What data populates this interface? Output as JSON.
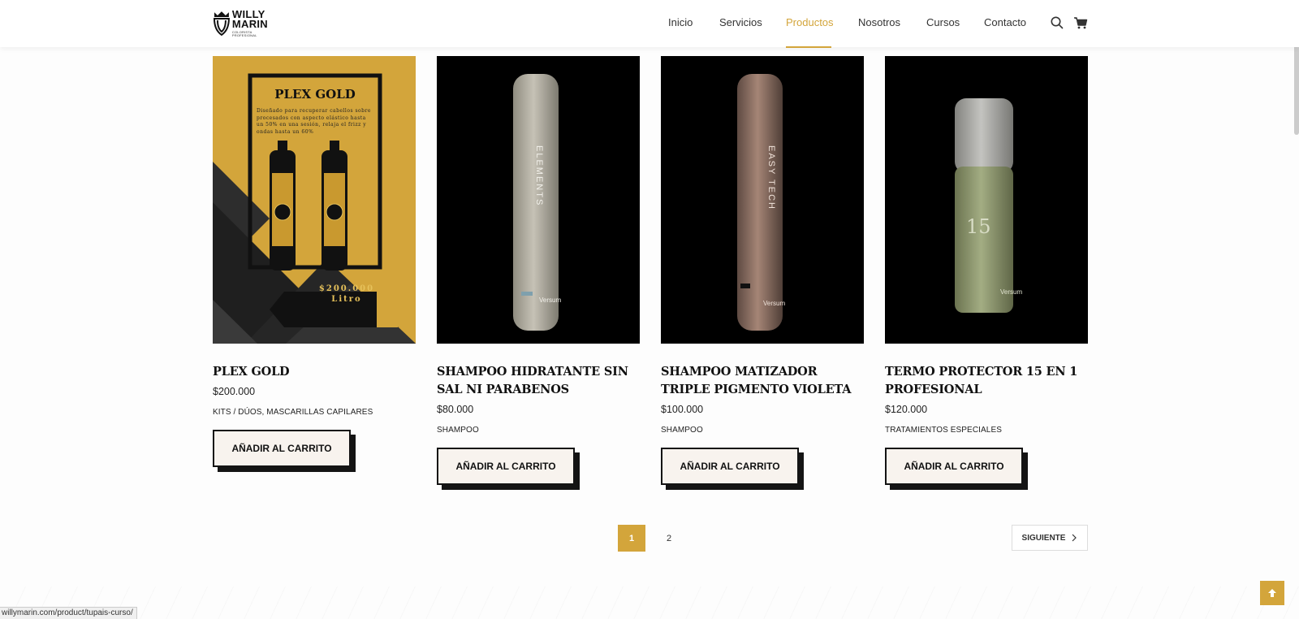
{
  "brand": {
    "name_line1": "WILLY",
    "name_line2": "MARIN",
    "tagline": "COLORISTA PROFESIONAL",
    "accent_color": "#d3a53b"
  },
  "nav": {
    "items": [
      {
        "label": "Inicio",
        "active": false
      },
      {
        "label": "Servicios",
        "active": false
      },
      {
        "label": "Productos",
        "active": true
      },
      {
        "label": "Nosotros",
        "active": false
      },
      {
        "label": "Cursos",
        "active": false
      },
      {
        "label": "Contacto",
        "active": false
      }
    ],
    "icons": [
      "search-icon",
      "cart-icon"
    ]
  },
  "products": [
    {
      "title": "PLEX GOLD",
      "price": "$200.000",
      "category": "KITS / DÚOS, MASCARILLAS CAPILARES",
      "button": "AÑADIR AL CARRITO",
      "image": {
        "poster_title": "PLEX GOLD",
        "poster_text": "Diseñado para recuperar cabellos sobre procesados con aspecto elástico hasta un 50% en una sesión, relaja el frizz y ondas hasta un 60%",
        "price_tag_line1": "$200.000",
        "price_tag_line2": "Litro"
      }
    },
    {
      "title": "SHAMPOO HIDRATANTE SIN SAL NI PARABENOS",
      "price": "$80.000",
      "category": "SHAMPOO",
      "button": "AÑADIR AL CARRITO",
      "image": {
        "bottle_label": "ELEMENTS",
        "bottle_brand": "Versum"
      }
    },
    {
      "title": "SHAMPOO MATIZADOR TRIPLE PIGMENTO VIOLETA",
      "price": "$100.000",
      "category": "SHAMPOO",
      "button": "AÑADIR AL CARRITO",
      "image": {
        "bottle_label": "EASY TECH",
        "bottle_brand": "Versum"
      }
    },
    {
      "title": "TERMO PROTECTOR 15 EN 1 PROFESIONAL",
      "price": "$120.000",
      "category": "TRATAMIENTOS ESPECIALES",
      "button": "AÑADIR AL CARRITO",
      "image": {
        "bottle_label": "15",
        "bottle_brand": "Versum"
      }
    }
  ],
  "pagination": {
    "pages": [
      "1",
      "2"
    ],
    "current": "1",
    "next_label": "SIGUIENTE"
  },
  "status_url": "willymarin.com/product/tupais-curso/"
}
